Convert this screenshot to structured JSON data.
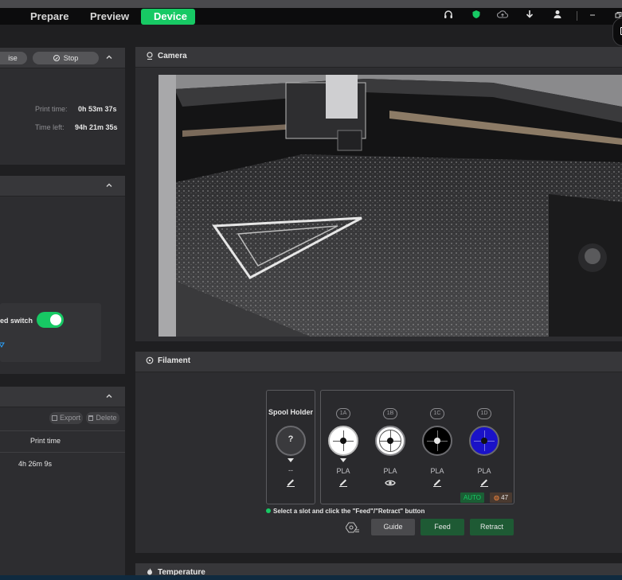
{
  "titlebar": {
    "tabs": [
      {
        "label": "Prepare"
      },
      {
        "label": "Preview"
      },
      {
        "label": "Device"
      }
    ]
  },
  "print_status": {
    "pause_label": "ise",
    "stop_label": "Stop",
    "print_time_label": "Print time:",
    "print_time_value": "0h 53m 37s",
    "time_left_label": "Time left:",
    "time_left_value": "94h 21m 35s"
  },
  "control": {
    "switch_label": "ed switch",
    "switch_on": true
  },
  "history": {
    "export_label": "Export",
    "delete_label": "Delete",
    "column_print_time": "Print time",
    "rows": [
      {
        "print_time": "4h 26m 9s"
      }
    ]
  },
  "camera": {
    "title": "Camera"
  },
  "filament": {
    "title": "Filament",
    "spool_holder_label": "Spool Holder",
    "spool_holder_value": "?",
    "spool_holder_type": "--",
    "slots": [
      {
        "id": "1A",
        "type": "PLA",
        "color": "#ffffff"
      },
      {
        "id": "1B",
        "type": "PLA",
        "color": "#ffffff"
      },
      {
        "id": "1C",
        "type": "PLA",
        "color": "#000000"
      },
      {
        "id": "1D",
        "type": "PLA",
        "color": "#1a12c8"
      }
    ],
    "auto_label": "AUTO",
    "humidity_value": "47",
    "hint": "Select a slot and click the \"Feed\"/\"Retract\" button",
    "guide_label": "Guide",
    "feed_label": "Feed",
    "retract_label": "Retract"
  },
  "temperature": {
    "title": "Temperature"
  },
  "colors": {
    "accent": "#17c964",
    "panel": "#2d2d30",
    "header": "#37373a"
  }
}
